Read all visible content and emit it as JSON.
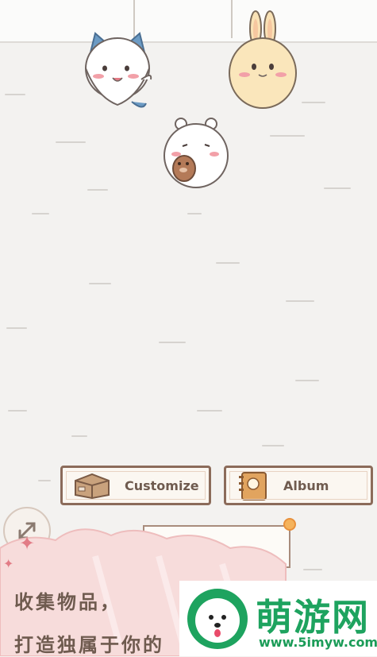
{
  "buttons": {
    "customize_label": "Customize",
    "album_label": "Album"
  },
  "promo": {
    "line1": "收集物品，",
    "line2": "打造独属于你的"
  },
  "watermark": {
    "title": "萌游网",
    "url": "www.5imyw.com"
  },
  "colors": {
    "accent_brown": "#8b6b5a",
    "watermark_green": "#1ea35f",
    "promo_pink": "#f7dcdb"
  },
  "icons": {
    "customize": "cardboard-box-icon",
    "album": "notebook-icon",
    "expand": "expand-arrows-icon"
  }
}
